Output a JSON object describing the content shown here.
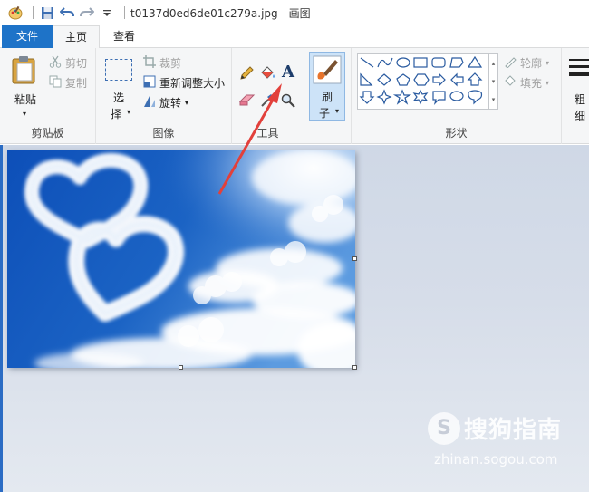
{
  "window": {
    "title": "t0137d0ed6de01c279a.jpg - 画图"
  },
  "tabs": {
    "file": "文件",
    "home": "主页",
    "view": "查看"
  },
  "clipboard": {
    "paste": "粘贴",
    "cut": "剪切",
    "copy": "复制",
    "label": "剪贴板"
  },
  "image": {
    "select_top": "选",
    "select_bottom": "择",
    "crop": "裁剪",
    "resize": "重新调整大小",
    "rotate": "旋转",
    "label": "图像"
  },
  "tools": {
    "label": "工具",
    "text_glyph": "A"
  },
  "brushes": {
    "top": "刷",
    "bottom": "子"
  },
  "shapes": {
    "label": "形状",
    "outline": "轮廓",
    "fill": "填充"
  },
  "size": {
    "top": "粗",
    "bottom": "细"
  },
  "watermark": {
    "logo": "S",
    "text": "搜狗指南",
    "url": "zhinan.sogou.com"
  },
  "colors": {
    "accent": "#1e73c8",
    "arrow": "#e2403b",
    "sky": "#1b63c4"
  }
}
